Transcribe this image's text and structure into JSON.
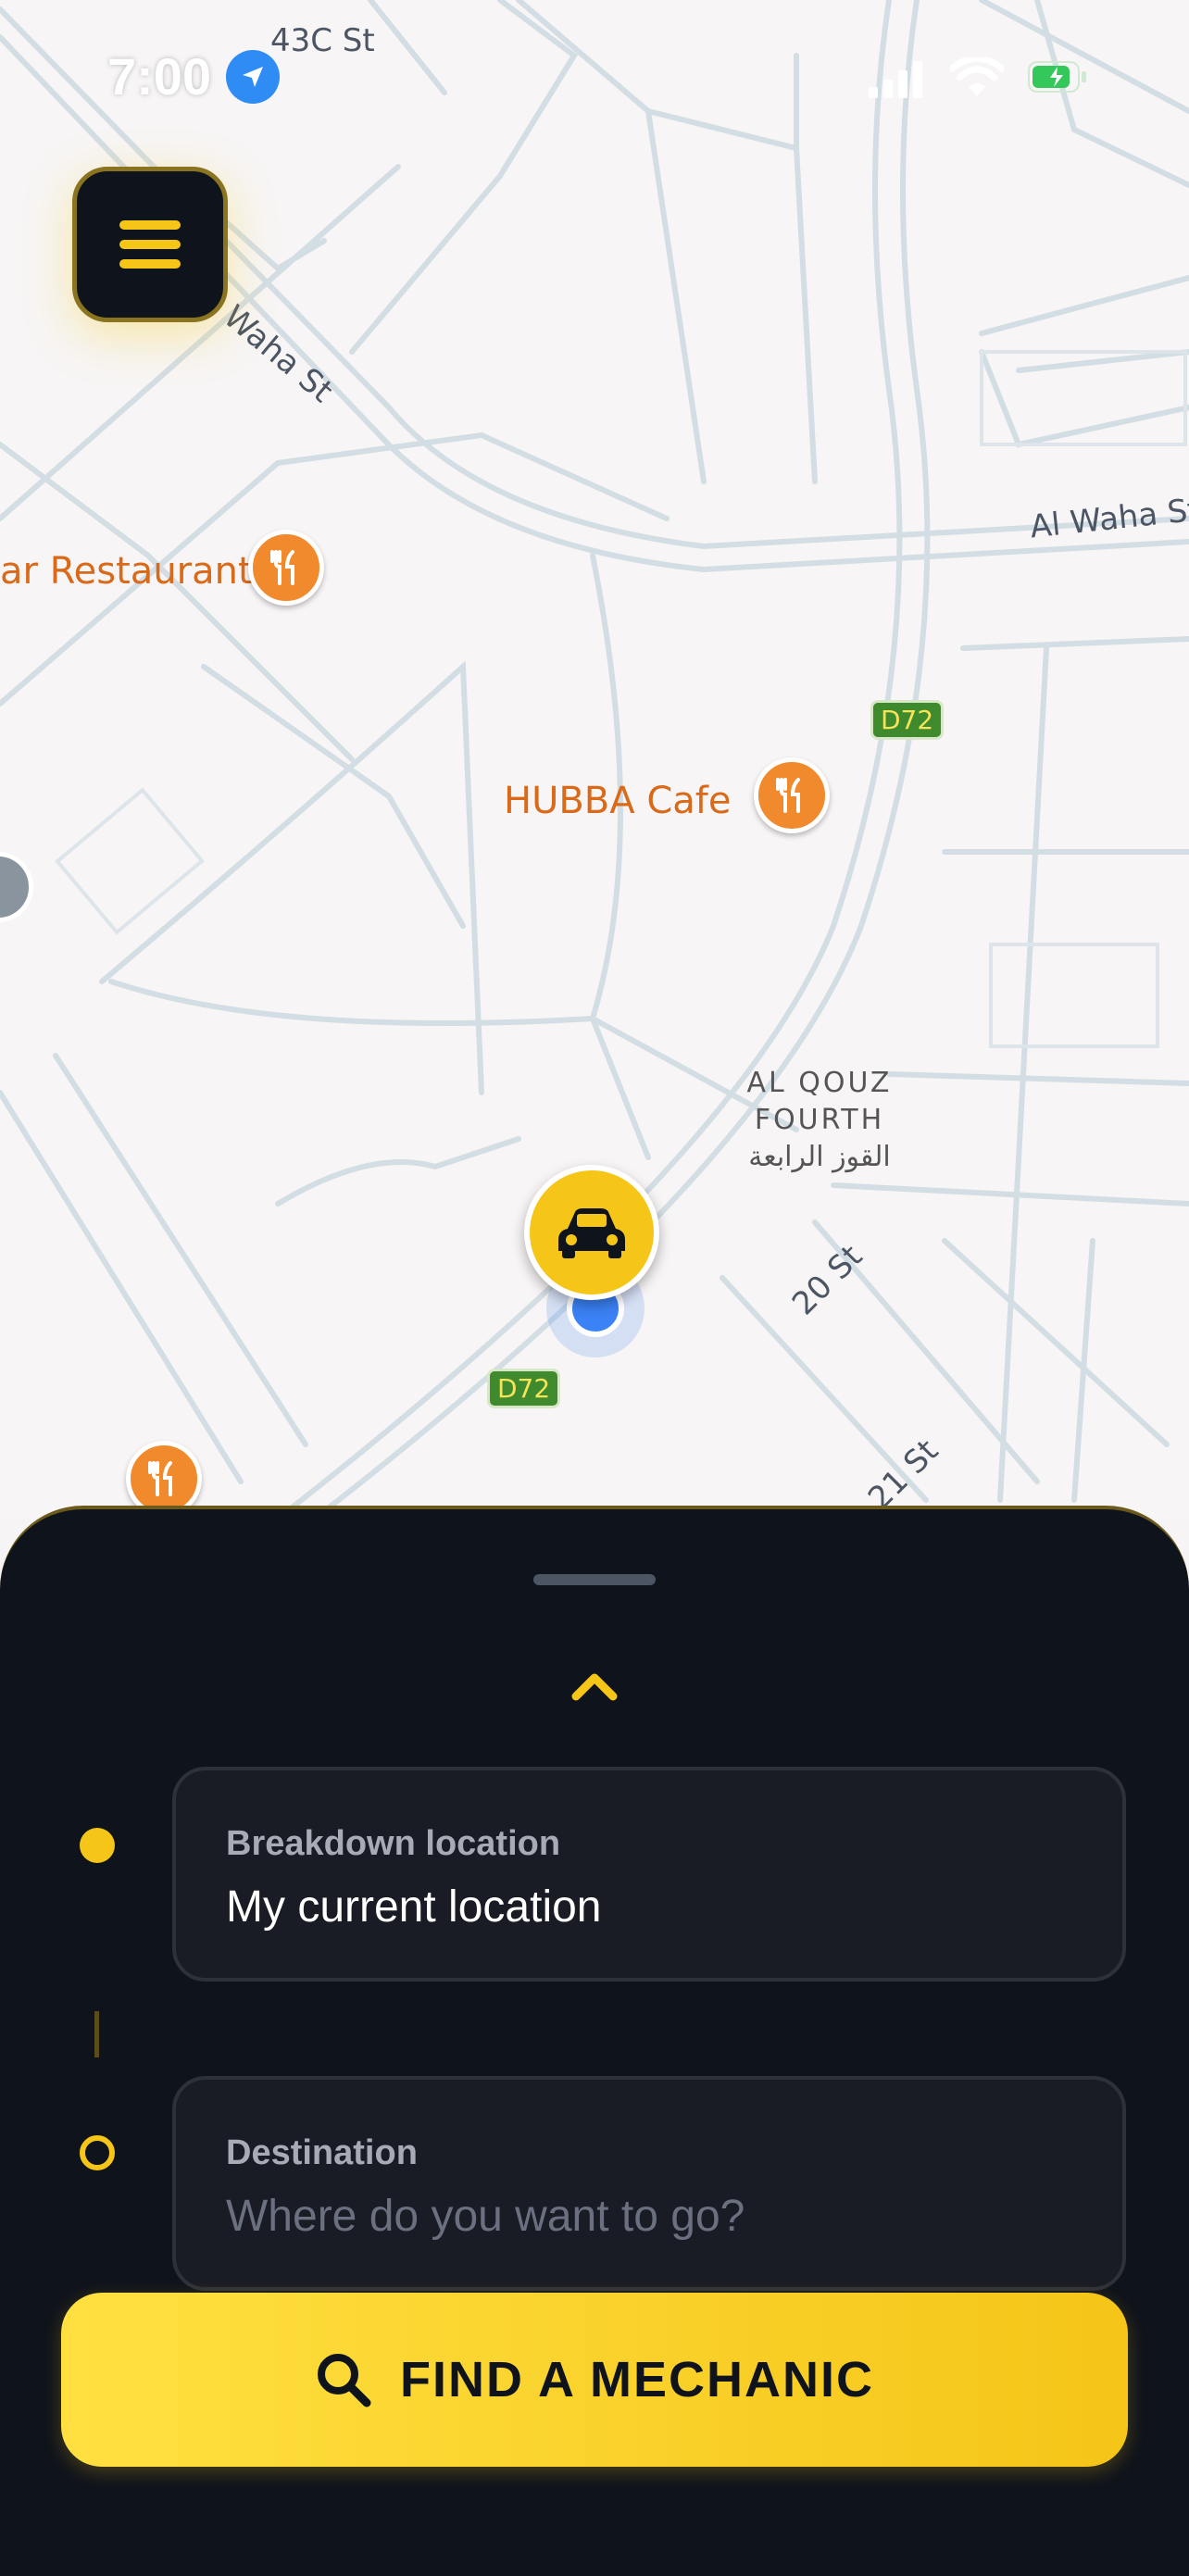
{
  "status_bar": {
    "time": "7:00"
  },
  "map": {
    "street_labels": {
      "top": "43C St",
      "waha_left": "Al Waha St",
      "waha_right": "Al Waha St",
      "street_20": "20 St",
      "street_21": "21 St"
    },
    "pois": {
      "restaurant_left": "ar Restaurant",
      "hubba_cafe": "HUBBA Cafe"
    },
    "route_shields": {
      "upper": "D72",
      "lower": "D72"
    },
    "district": {
      "line1": "AL QOUZ",
      "line2": "FOURTH",
      "line3": "القوز الرابعة"
    }
  },
  "bottom_sheet": {
    "pickup": {
      "label": "Breakdown location",
      "value": "My current location"
    },
    "destination": {
      "label": "Destination",
      "placeholder": "Where do you want to go?"
    },
    "cta_label": "FIND A MECHANIC"
  },
  "colors": {
    "accent": "#f5c518",
    "sheet_bg": "#0f131b",
    "field_bg": "#191c24",
    "poi": "#f08a2c"
  },
  "icons": [
    "location-arrow-icon",
    "signal-icon",
    "wifi-icon",
    "battery-icon",
    "hamburger-menu-icon",
    "car-icon",
    "fork-knife-icon",
    "chevron-up-icon",
    "search-icon"
  ]
}
